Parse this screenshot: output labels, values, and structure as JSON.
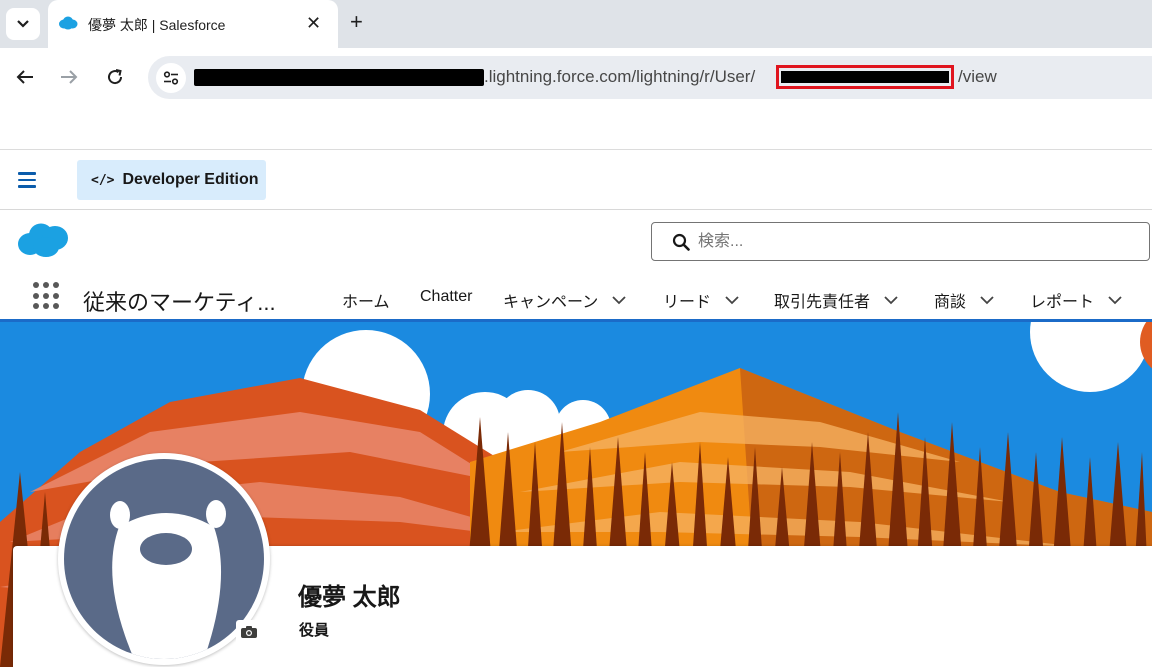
{
  "browser": {
    "tab_title": "優夢 太郎 | Salesforce",
    "url_domain_suffix": ".lightning.force.com/lightning/r/User/",
    "url_suffix": "/view",
    "icons": {
      "tab_menu": "chevron-down-icon",
      "close": "close-icon",
      "new_tab": "plus-icon",
      "back": "back-arrow-icon",
      "forward": "forward-arrow-icon",
      "reload": "reload-icon",
      "site_info": "tune-icon"
    },
    "highlight_color": "#e0141e"
  },
  "setup_bar": {
    "edition_label": "Developer Edition"
  },
  "header": {
    "search_placeholder": "検索..."
  },
  "app_nav": {
    "app_name": "従来のマーケティ...",
    "items": [
      {
        "label": "ホーム",
        "has_menu": false
      },
      {
        "label": "Chatter",
        "has_menu": false
      },
      {
        "label": "キャンペーン",
        "has_menu": true
      },
      {
        "label": "リード",
        "has_menu": true
      },
      {
        "label": "取引先責任者",
        "has_menu": true
      },
      {
        "label": "商談",
        "has_menu": true
      },
      {
        "label": "レポート",
        "has_menu": true
      }
    ],
    "accent_color": "#1b6bc8"
  },
  "profile": {
    "name": "優夢 太郎",
    "title": "役員"
  },
  "colors": {
    "brand_blue": "#0b5cab",
    "salesforce_cloud": "#1ba1e2",
    "dev_edition_bg": "#d8ecfc",
    "avatar_bg": "#5a6a88"
  }
}
